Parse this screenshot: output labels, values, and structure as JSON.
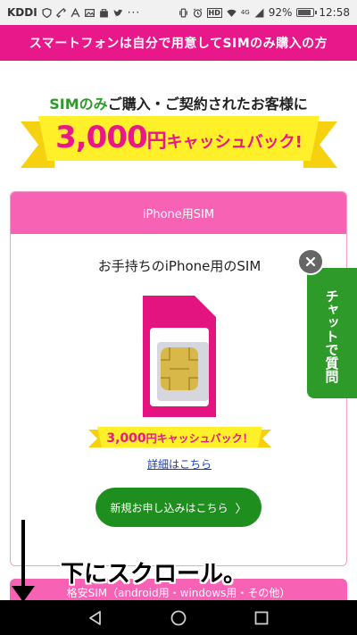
{
  "status_bar": {
    "carrier": "KDDI",
    "ellipsis": "···",
    "hd": "HD",
    "net": "4G",
    "battery_percent": "92%",
    "battery_level": 0.92,
    "time": "12:58",
    "icons": [
      "shield-icon",
      "link-icon",
      "a-icon",
      "image-icon",
      "bag-icon",
      "twitter-icon",
      "vibrate-icon",
      "alarm-icon",
      "wifi-icon",
      "signal-icon",
      "battery-icon"
    ]
  },
  "header": {
    "title": "スマートフォンは自分で用意してSIMのみ購入の方"
  },
  "promo": {
    "sub_green": "SIMのみ",
    "sub_rest": "ご購入・ご契約されたお客様に",
    "amount": "3,000",
    "yen": "円",
    "cashback": "キャッシュバック!"
  },
  "card": {
    "header": "iPhone用SIM",
    "title": "お手持ちのiPhone用のSIM",
    "ribbon_amount": "3,000",
    "ribbon_yen": "円",
    "ribbon_cashback": "キャッシュバック！",
    "detail_link": "詳細はこちら",
    "apply_button": "新規お申し込みはこちら",
    "apply_chevron": "〉"
  },
  "next_section": {
    "label": "格安SIM（android用・windows用・その他）"
  },
  "chat": {
    "label": "チャットで質問",
    "close": "×"
  },
  "annotation": {
    "text": "下にスクロール。"
  },
  "colors": {
    "pink": "#e8178a",
    "card_pink": "#f762b4",
    "green": "#2e9a2a",
    "yellow": "#fff02a"
  },
  "nav": [
    "back-icon",
    "home-icon",
    "recents-icon"
  ]
}
